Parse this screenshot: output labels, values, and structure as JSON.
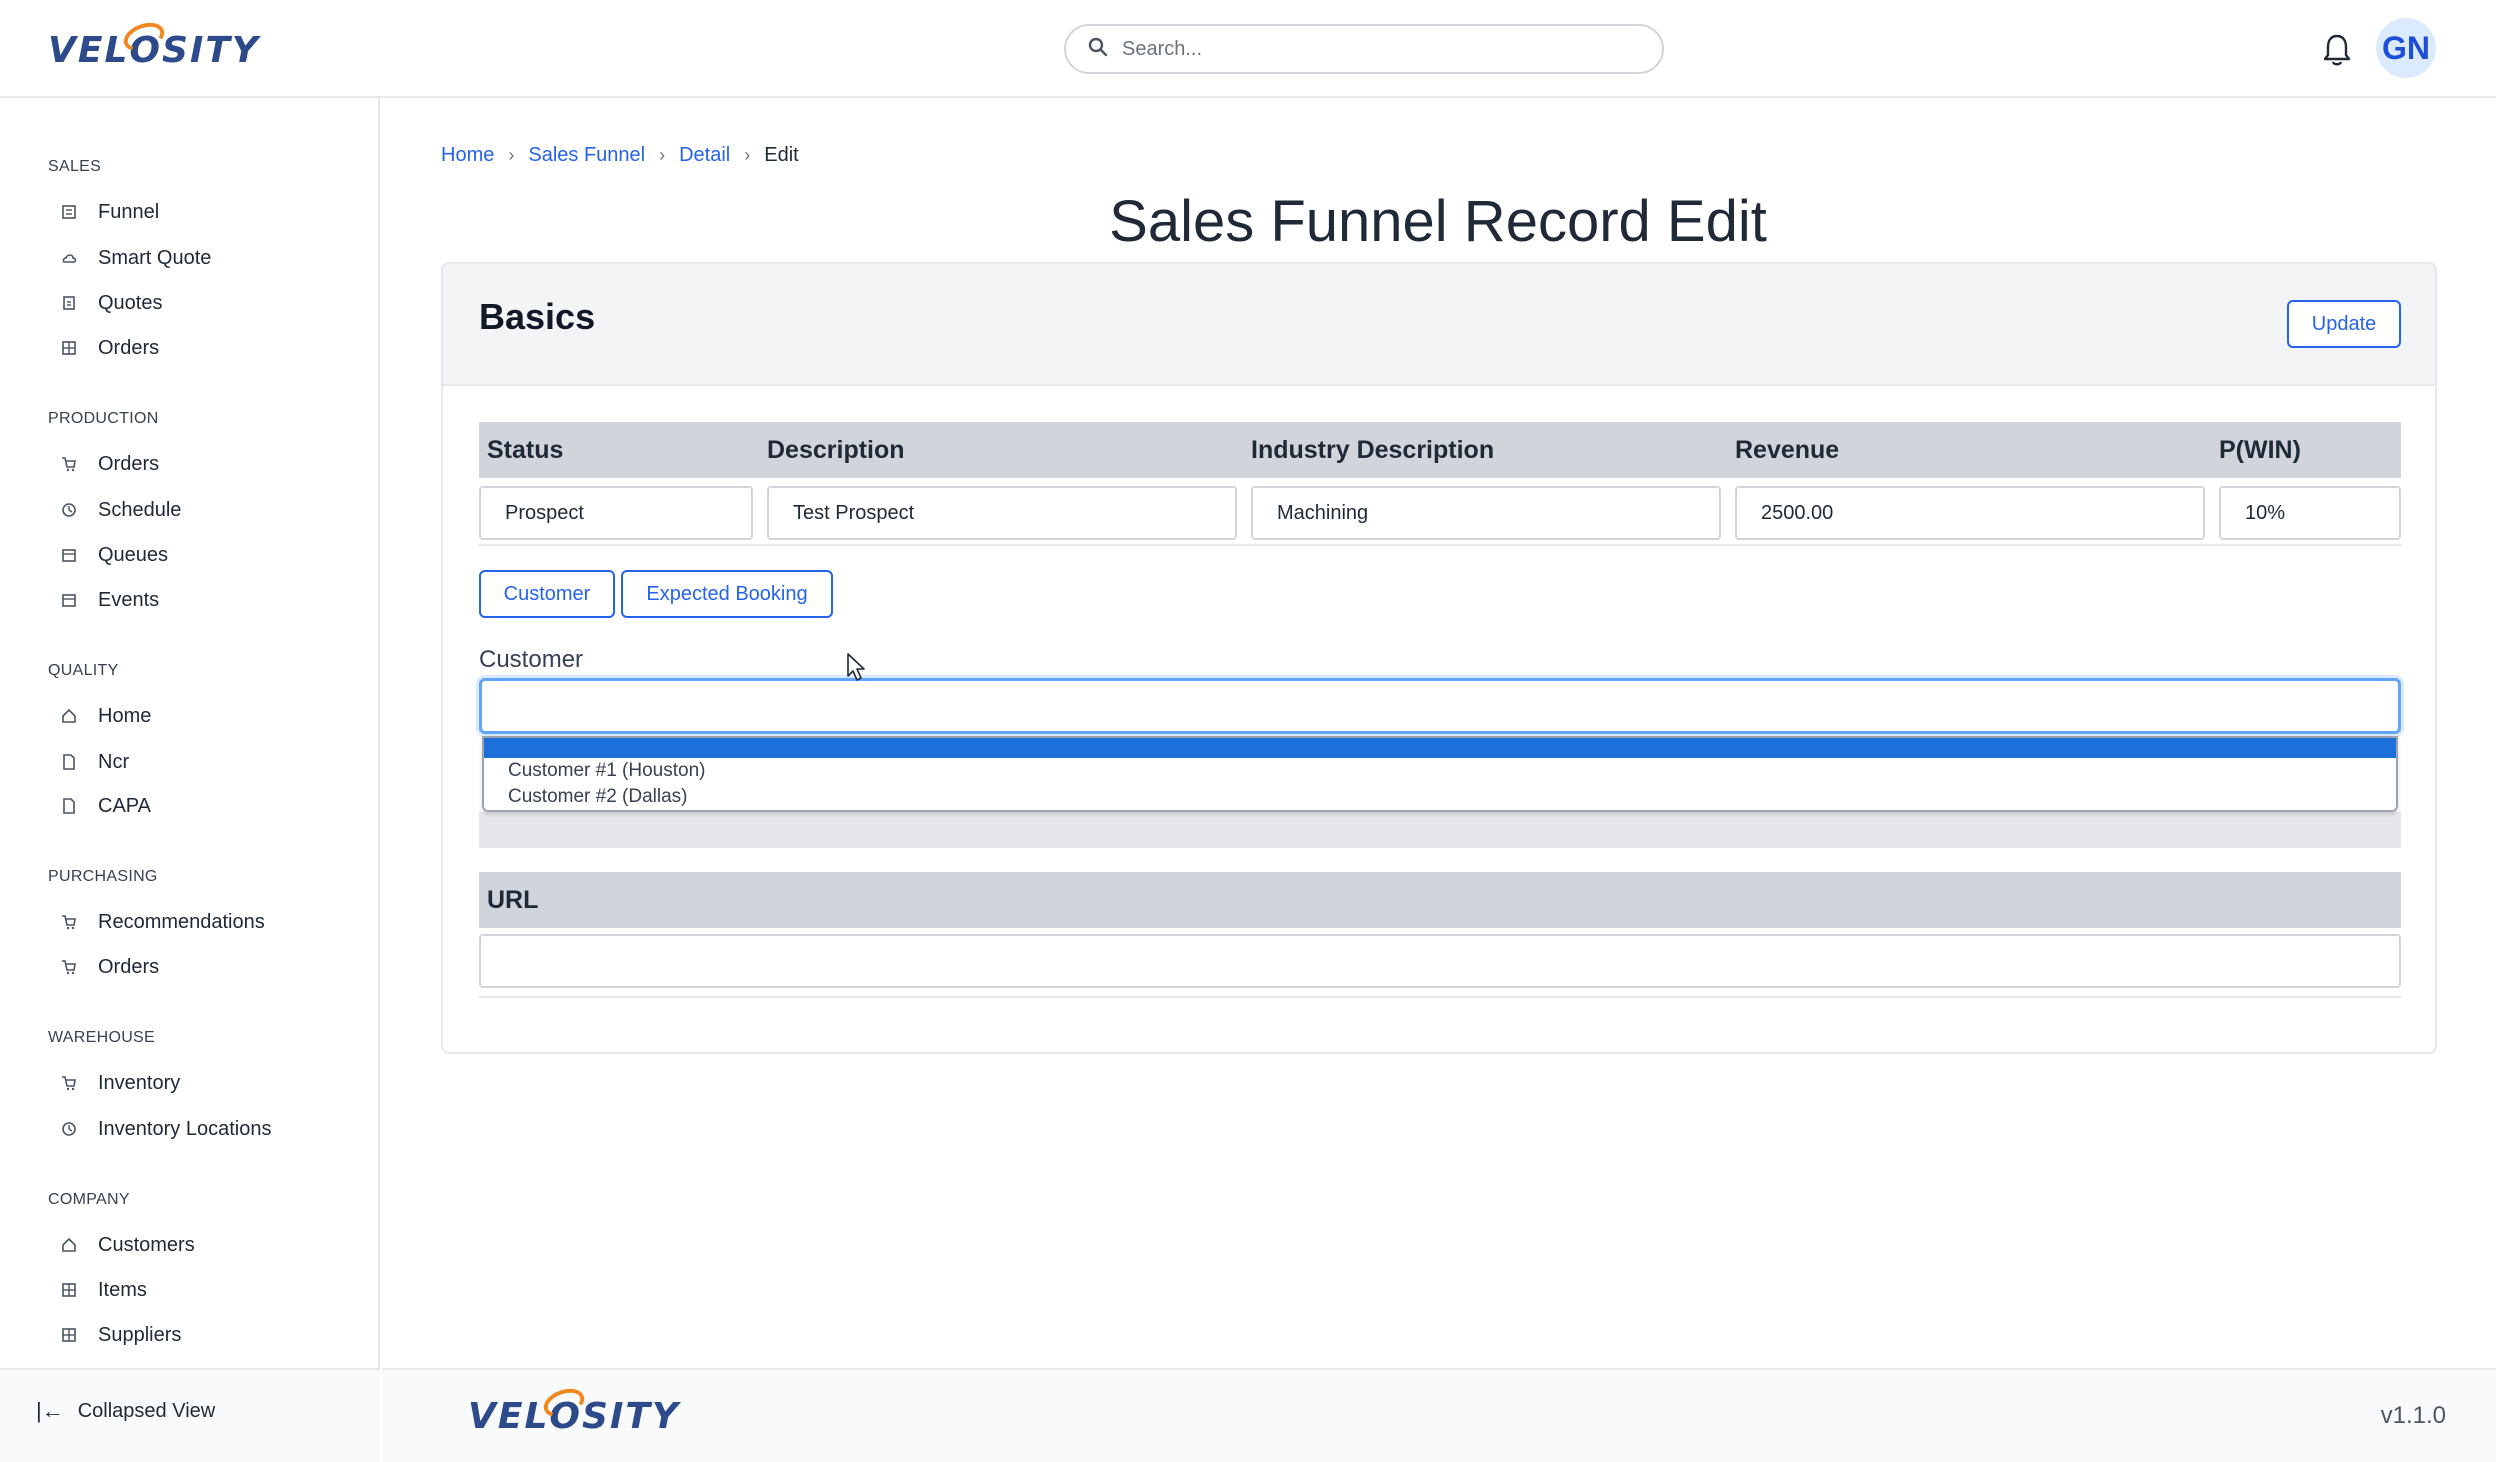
{
  "header": {
    "logo_text_a": "VEL",
    "logo_text_o": "O",
    "logo_text_b": "SITY",
    "search_placeholder": "Search...",
    "avatar_initials": "GN"
  },
  "sidebar": {
    "sections": [
      {
        "title": "SALES",
        "items": [
          "Funnel",
          "Smart Quote",
          "Quotes",
          "Orders"
        ]
      },
      {
        "title": "PRODUCTION",
        "items": [
          "Orders",
          "Schedule",
          "Queues",
          "Events"
        ]
      },
      {
        "title": "QUALITY",
        "items": [
          "Home",
          "Ncr",
          "CAPA"
        ]
      },
      {
        "title": "PURCHASING",
        "items": [
          "Recommendations",
          "Orders"
        ]
      },
      {
        "title": "WAREHOUSE",
        "items": [
          "Inventory",
          "Inventory Locations"
        ]
      },
      {
        "title": "COMPANY",
        "items": [
          "Customers",
          "Items",
          "Suppliers"
        ]
      }
    ],
    "collapse_label": "Collapsed View"
  },
  "breadcrumb": {
    "home": "Home",
    "funnel": "Sales Funnel",
    "detail": "Detail",
    "current": "Edit"
  },
  "page_title": "Sales Funnel Record Edit",
  "card": {
    "title": "Basics",
    "update_label": "Update",
    "columns": [
      "Status",
      "Description",
      "Industry Description",
      "Revenue",
      "P(WIN)"
    ],
    "values": [
      "Prospect",
      "Test Prospect",
      "Machining",
      "2500.00",
      "10%"
    ],
    "tabs": [
      "Customer",
      "Expected Booking"
    ],
    "customer_label": "Customer",
    "customer_options": [
      "Customer #1 (Houston)",
      "Customer #2 (Dallas)"
    ],
    "url_label": "URL"
  },
  "footer": {
    "version": "v1.1.0"
  },
  "colors": {
    "accent": "#2563eb",
    "logo_blue": "#2d4a8a",
    "logo_orange": "#f2871e",
    "dropdown_selected": "#1d6fdc"
  }
}
